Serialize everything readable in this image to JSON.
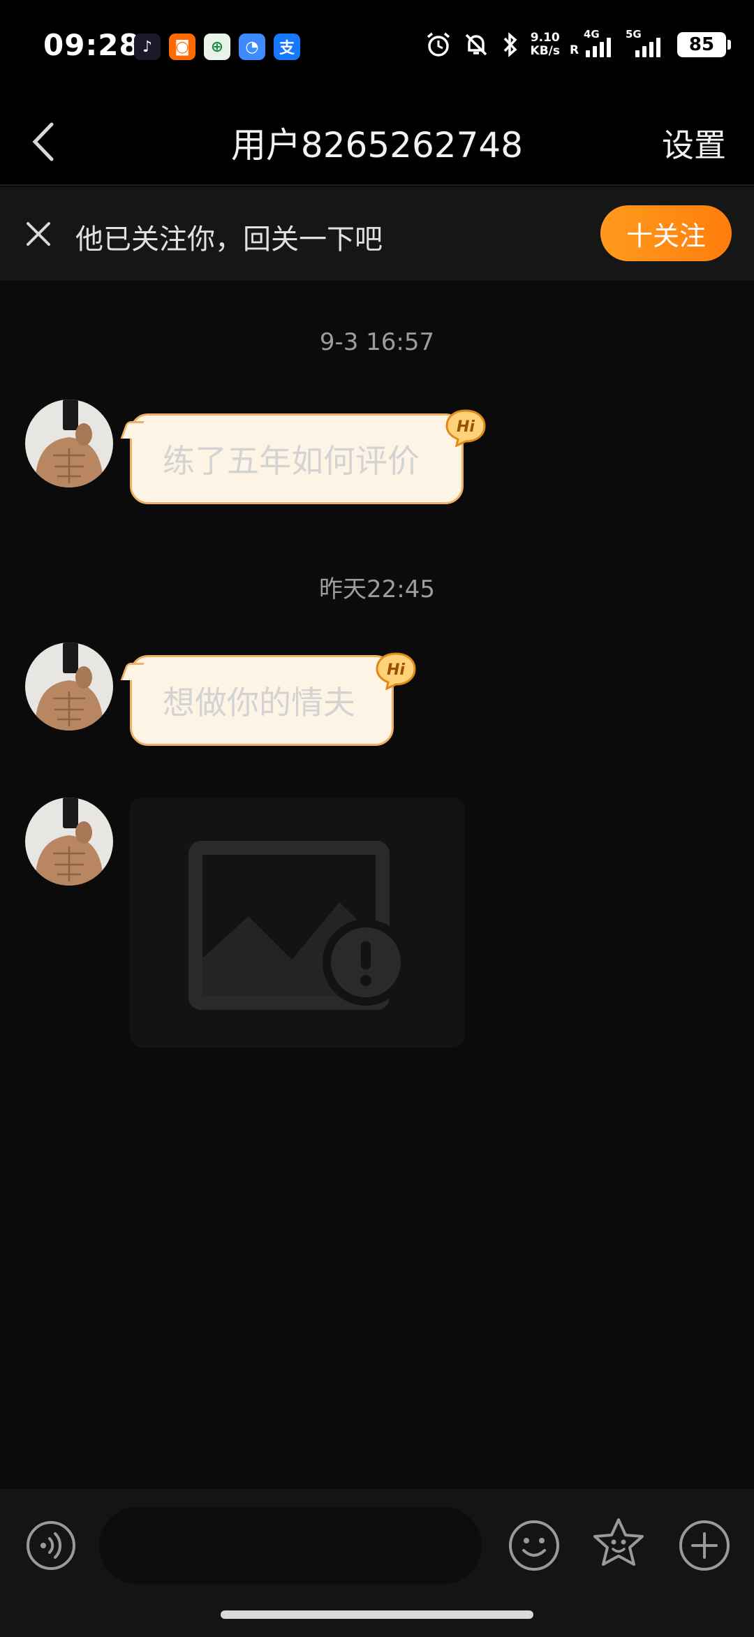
{
  "status_bar": {
    "time": "09:28",
    "speed_value": "9.10",
    "speed_unit": "KB/s",
    "network_1": "4G",
    "network_2": "5G",
    "roaming": "R",
    "battery": "85",
    "app_icons": [
      "douyin-icon",
      "taobao-icon",
      "bank-icon",
      "app-icon",
      "alipay-icon"
    ]
  },
  "header": {
    "title": "用户8265262748",
    "settings_label": "设置"
  },
  "follow_banner": {
    "text": "他已关注你，回关一下吧",
    "follow_button": "十关注"
  },
  "messages": [
    {
      "timestamp": "9-3 16:57",
      "type": "text",
      "text": "练了五年如何评价",
      "badge": "Hi"
    },
    {
      "timestamp": "昨天22:45",
      "type": "text",
      "text": "想做你的情夫",
      "badge": "Hi"
    },
    {
      "type": "image",
      "status": "failed-to-load"
    }
  ],
  "input_bar": {
    "placeholder": ""
  },
  "colors": {
    "accent": "#ff8a15",
    "bubble_bg": "#fdf4e6",
    "bubble_border": "#f0b066",
    "background": "#0b0b0b"
  }
}
